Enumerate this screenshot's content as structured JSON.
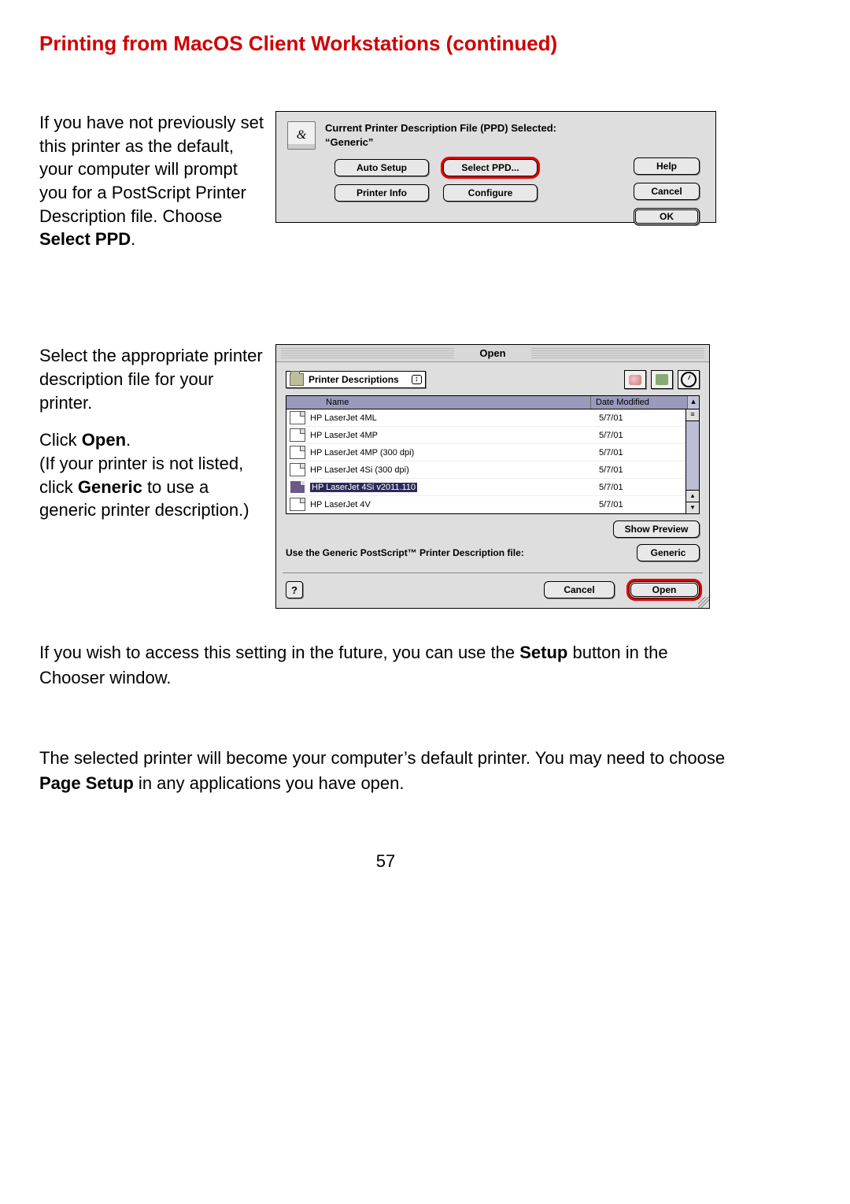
{
  "heading": "Printing from MacOS Client Workstations (continued)",
  "section1": {
    "instr_pre": "If you have not previously set this printer as the default, your computer will prompt you for a PostScript Printer Description file. Choose ",
    "instr_bold": "Select PPD",
    "instr_post": "."
  },
  "dialog1": {
    "title_line1": "Current Printer Description File (PPD) Selected:",
    "title_line2": "“Generic”",
    "icon_glyph": "&",
    "btn_auto": "Auto Setup",
    "btn_select": "Select PPD...",
    "btn_info": "Printer Info",
    "btn_config": "Configure",
    "btn_help": "Help",
    "btn_cancel": "Cancel",
    "btn_ok": "OK"
  },
  "section2": {
    "p1": "Select the appropriate printer description file for your printer.",
    "p2_pre": "Click ",
    "p2_bold": "Open",
    "p2_post": ".",
    "p3_pre": "(If your printer is not listed, click ",
    "p3_bold": "Generic",
    "p3_post": " to use a generic printer description.)"
  },
  "dialog2": {
    "title": "Open",
    "popup_label": "Printer Descriptions",
    "popup_arrows": "↕",
    "col_name": "Name",
    "col_date": "Date Modified",
    "sort_glyph": "▴",
    "files": [
      {
        "name": "HP LaserJet 4ML",
        "date": "5/7/01",
        "selected": false
      },
      {
        "name": "HP LaserJet 4MP",
        "date": "5/7/01",
        "selected": false
      },
      {
        "name": "HP LaserJet 4MP (300 dpi)",
        "date": "5/7/01",
        "selected": false
      },
      {
        "name": "HP LaserJet 4Si (300 dpi)",
        "date": "5/7/01",
        "selected": false
      },
      {
        "name": "HP LaserJet 4Si v2011.110",
        "date": "5/7/01",
        "selected": true
      },
      {
        "name": "HP LaserJet 4V",
        "date": "5/7/01",
        "selected": false
      }
    ],
    "scroll_up": "▴",
    "scroll_down": "▾",
    "btn_showprev": "Show Preview",
    "generic_label": "Use the Generic PostScript™ Printer Description file:",
    "btn_generic": "Generic",
    "help_glyph": "?",
    "btn_cancel": "Cancel",
    "btn_open": "Open"
  },
  "after1_pre": "If you wish to access this setting in the future, you can use the ",
  "after1_bold": "Setup",
  "after1_post": " button in the Chooser window.",
  "after2_pre": "The selected printer will become your computer’s default printer. You may need to choose ",
  "after2_bold": "Page Setup",
  "after2_post": " in any applications you have open.",
  "page_number": "57"
}
